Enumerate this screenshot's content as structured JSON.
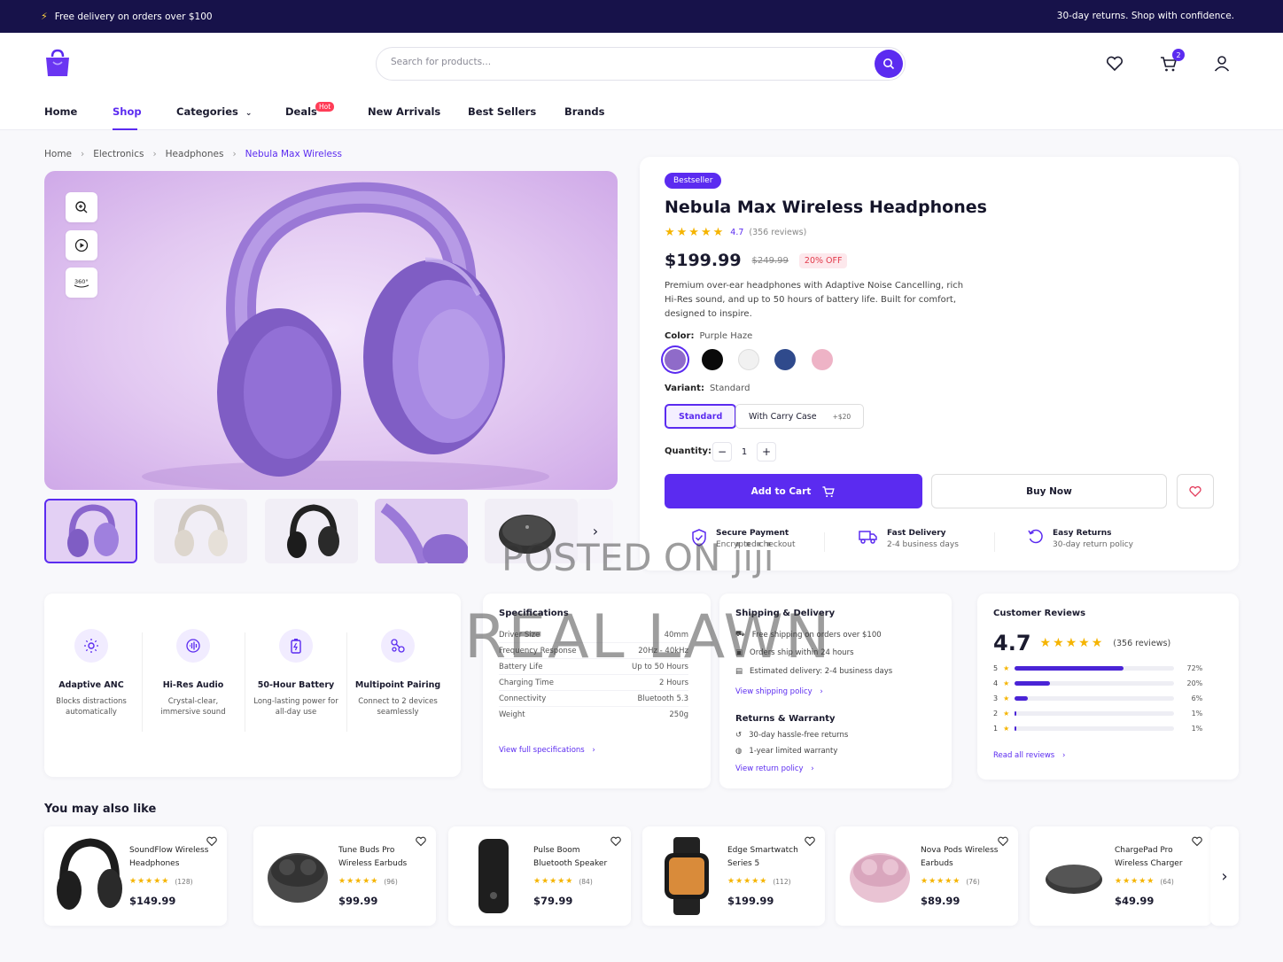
{
  "topbar": {
    "left_text": "Free delivery on orders over $100",
    "right_text": "30-day returns. Shop with confidence."
  },
  "search": {
    "placeholder": "Search for products..."
  },
  "cart": {
    "count": "2"
  },
  "nav": {
    "items": [
      "Home",
      "Shop",
      "Categories",
      "Deals",
      "New Arrivals",
      "Best Sellers",
      "Brands"
    ],
    "hot_badge": "Hot"
  },
  "breadcrumb": [
    "Home",
    "Electronics",
    "Headphones",
    "Nebula Max Wireless"
  ],
  "product": {
    "badge": "Bestseller",
    "title": "Nebula Max Wireless Headphones",
    "rating": "4.7",
    "reviews": "(356 reviews)",
    "price": "$199.99",
    "old_price": "$249.99",
    "discount": "20% OFF",
    "description": "Premium over-ear headphones with Adaptive Noise Cancelling, rich Hi-Res sound, and up to 50 hours of battery life. Built for comfort, designed to inspire.",
    "color_label": "Color:",
    "color_value": "Purple Haze",
    "colors": [
      "#8f6bc9",
      "#0a0a0a",
      "#f1f1f1",
      "#2f4a8c",
      "#eeb3c6"
    ],
    "variant_label": "Variant:",
    "variant_value": "Standard",
    "variants": [
      {
        "label": "Standard",
        "extra": ""
      },
      {
        "label": "With Carry Case",
        "extra": "+$20"
      }
    ],
    "quantity_label": "Quantity:",
    "quantity": "1",
    "add_to_cart": "Add to Cart",
    "buy_now": "Buy Now",
    "perks": [
      {
        "title": "Secure Payment",
        "sub": "Encrypted checkout"
      },
      {
        "title": "Fast Delivery",
        "sub": "2-4 business days"
      },
      {
        "title": "Easy Returns",
        "sub": "30-day return policy"
      }
    ]
  },
  "features": [
    {
      "title": "Adaptive ANC",
      "sub": "Blocks distractions automatically"
    },
    {
      "title": "Hi-Res Audio",
      "sub": "Crystal-clear, immersive sound"
    },
    {
      "title": "50-Hour Battery",
      "sub": "Long-lasting power for all-day use"
    },
    {
      "title": "Multipoint Pairing",
      "sub": "Connect to 2 devices seamlessly"
    }
  ],
  "specs": {
    "title": "Specifications",
    "rows": [
      {
        "k": "Driver Size",
        "v": "40mm"
      },
      {
        "k": "Frequency Response",
        "v": "20Hz - 40kHz"
      },
      {
        "k": "Battery Life",
        "v": "Up to 50 Hours"
      },
      {
        "k": "Charging Time",
        "v": "2 Hours"
      },
      {
        "k": "Connectivity",
        "v": "Bluetooth 5.3"
      },
      {
        "k": "Weight",
        "v": "250g"
      }
    ],
    "link": "View full specifications"
  },
  "shipping": {
    "title": "Shipping & Delivery",
    "rows": [
      "Free shipping on orders over $100",
      "Orders ship within 24 hours",
      "Estimated delivery: 2-4 business days"
    ],
    "link": "View shipping policy",
    "returns_title": "Returns & Warranty",
    "returns_rows": [
      "30-day hassle-free returns",
      "1-year limited warranty"
    ],
    "returns_link": "View return policy"
  },
  "reviews": {
    "title": "Customer Reviews",
    "avg": "4.7",
    "count": "(356 reviews)",
    "bars": [
      {
        "star": "5",
        "pct": "72%",
        "fill": 0.68
      },
      {
        "star": "4",
        "pct": "20%",
        "fill": 0.22
      },
      {
        "star": "3",
        "pct": "6%",
        "fill": 0.08
      },
      {
        "star": "2",
        "pct": "1%",
        "fill": 0.01
      },
      {
        "star": "1",
        "pct": "1%",
        "fill": 0.01
      }
    ],
    "link": "Read all reviews"
  },
  "recommend": {
    "title": "You may also like",
    "items": [
      {
        "name": "SoundFlow Wireless Headphones",
        "count": "(128)",
        "price": "$149.99",
        "icon": "headphones-icon"
      },
      {
        "name": "Tune Buds Pro Wireless Earbuds",
        "count": "(96)",
        "price": "$99.99",
        "icon": "earbuds-icon"
      },
      {
        "name": "Pulse Boom Bluetooth Speaker",
        "count": "(84)",
        "price": "$79.99",
        "icon": "speaker-icon"
      },
      {
        "name": "Edge Smartwatch Series 5",
        "count": "(112)",
        "price": "$199.99",
        "icon": "smartwatch-icon"
      },
      {
        "name": "Nova Pods Wireless Earbuds",
        "count": "(76)",
        "price": "$89.99",
        "icon": "earbuds-icon"
      },
      {
        "name": "ChargePad Pro Wireless Charger",
        "count": "(64)",
        "price": "$49.99",
        "icon": "charger-icon"
      }
    ]
  },
  "watermarks": [
    "POSTED ON jiji",
    "REAL LAWN"
  ]
}
